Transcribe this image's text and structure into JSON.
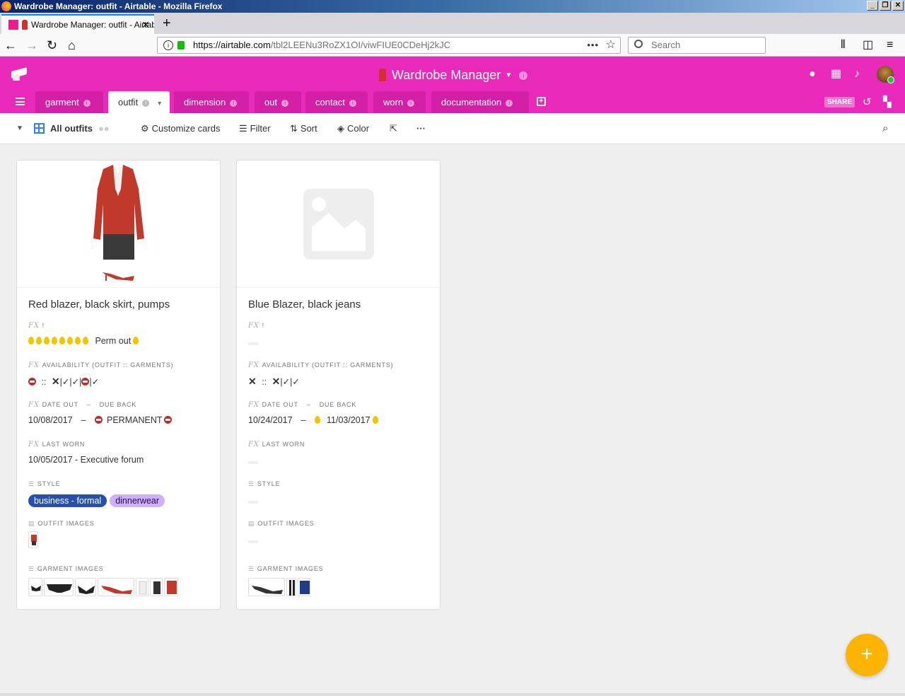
{
  "window": {
    "title": "Wardrobe Manager: outfit - Airtable - Mozilla Firefox"
  },
  "browser": {
    "tab_title": "Wardrobe Manager: outfit - Airtable",
    "url_host": "https://airtable.com",
    "url_path": "/tbl2LEENu3RoZX1OI/viwFIUE0CDeHj2kJC",
    "search_placeholder": "Search"
  },
  "app": {
    "base_name": "Wardrobe Manager",
    "accent": "#e929ba",
    "tables": [
      {
        "label": "garment"
      },
      {
        "label": "outfit"
      },
      {
        "label": "dimension"
      },
      {
        "label": "out"
      },
      {
        "label": "contact"
      },
      {
        "label": "worn"
      },
      {
        "label": "documentation"
      }
    ],
    "share_label": "SHARE"
  },
  "viewbar": {
    "view_name": "All outfits",
    "customize": "Customize cards",
    "filter": "Filter",
    "sort": "Sort",
    "color": "Color"
  },
  "fields": {
    "bang": "!",
    "availability": "AVAILABILITY (OUTFIT :: GARMENTS)",
    "date_out": "DATE OUT",
    "dash": "–",
    "due_back": "DUE BACK",
    "last_worn": "LAST WORN",
    "style": "STYLE",
    "outfit_images": "OUTFIT IMAGES",
    "garment_images": "GARMENT IMAGES"
  },
  "cards": [
    {
      "title": "Red blazer, black skirt, pumps",
      "bang_text": "Perm out",
      "availability_sep": "::",
      "date_out": "10/08/2017",
      "date_sep": "–",
      "due_back": "PERMANENT",
      "last_worn": "10/05/2017 - Executive forum",
      "styles": [
        {
          "label": "business - formal",
          "bg": "#2750ae",
          "fg": "#ffffff"
        },
        {
          "label": "dinnerwear",
          "bg": "#cdb0ff",
          "fg": "#280b42"
        }
      ]
    },
    {
      "title": "Blue Blazer, black jeans",
      "availability_sep": "::",
      "date_out": "10/24/2017",
      "date_sep": "–",
      "due_back": "11/03/2017"
    }
  ],
  "fab_label": "+"
}
